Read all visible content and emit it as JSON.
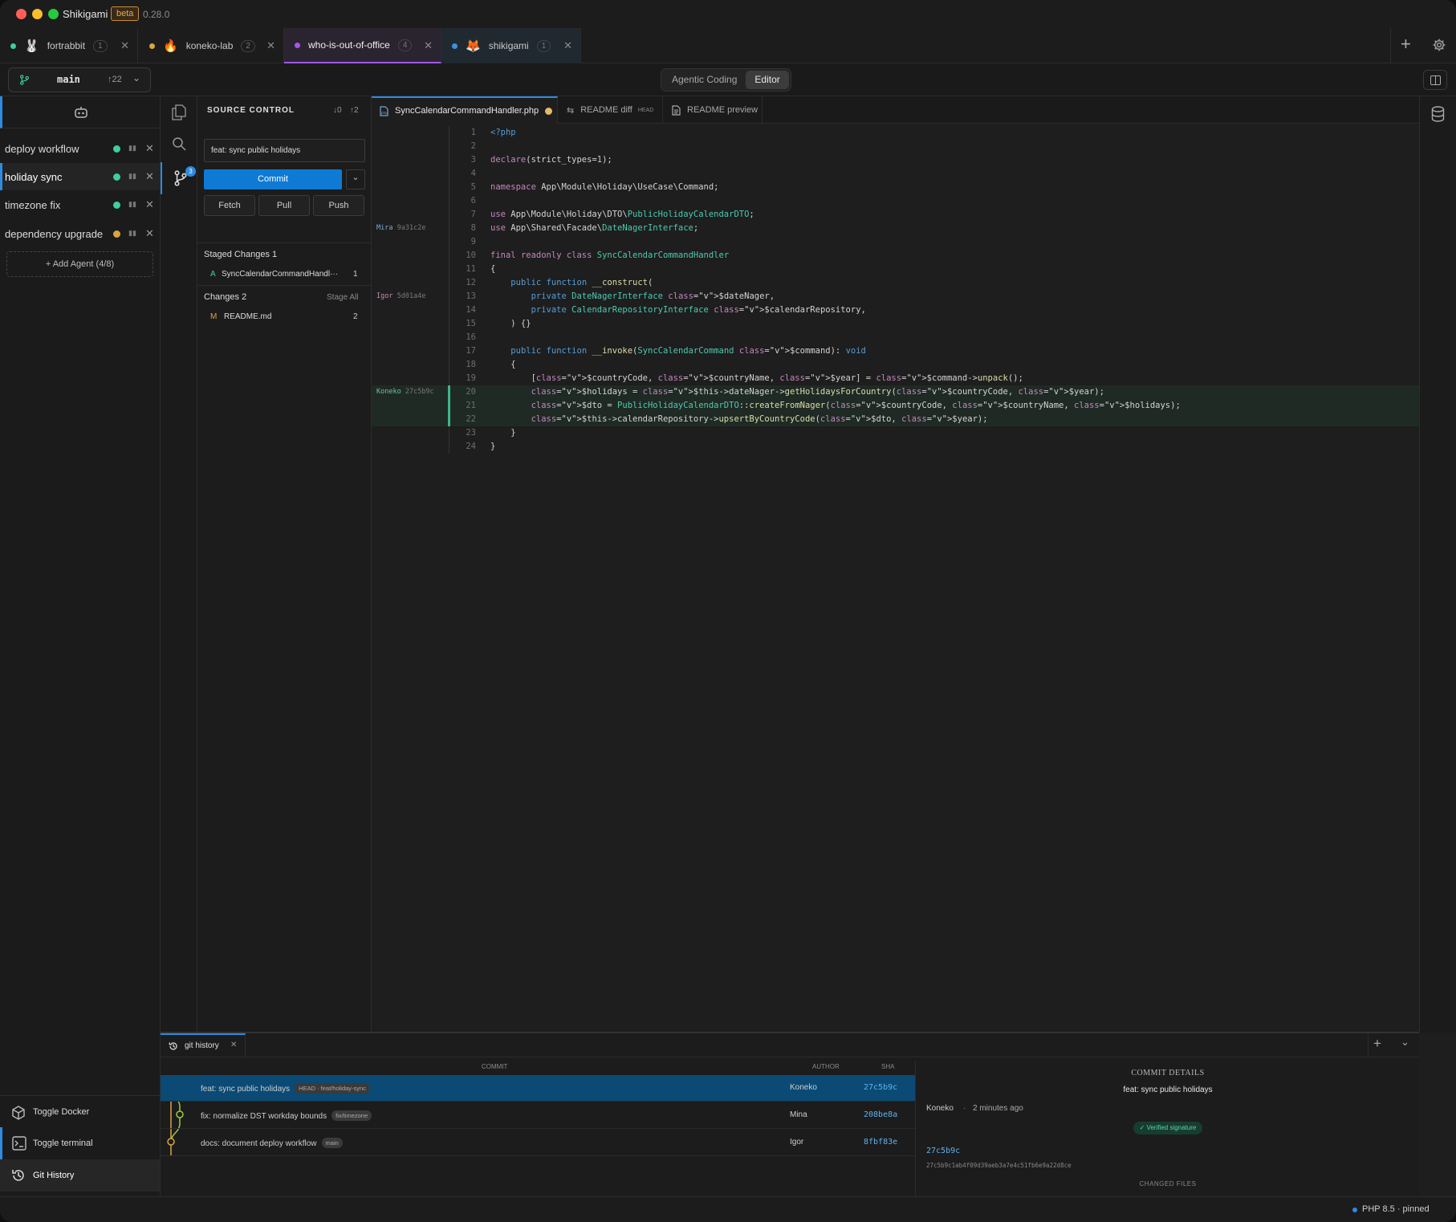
{
  "app": {
    "name": "Shikigami",
    "badge": "beta",
    "version": "0.28.0"
  },
  "project_tabs": [
    {
      "label": "fortrabbit",
      "count": "1",
      "dot": "#3ecf9a",
      "emoji": "🐰"
    },
    {
      "label": "koneko-lab",
      "count": "2",
      "dot": "#d9a441",
      "emoji": "🔥"
    },
    {
      "label": "who-is-out-of-office",
      "count": "4",
      "dot": "#a259e6",
      "emoji": ""
    },
    {
      "label": "shikigami",
      "count": "1",
      "dot": "#3d8fe0",
      "emoji": "🦊"
    }
  ],
  "toolbar": {
    "branch": "main",
    "ahead": "↑22",
    "modes": [
      "Agentic Coding",
      "Editor"
    ],
    "active_mode": "Editor"
  },
  "agents": [
    {
      "label": "deploy workflow",
      "status": "#3ecf9a"
    },
    {
      "label": "holiday sync",
      "status": "#3ecf9a",
      "active": true
    },
    {
      "label": "timezone fix",
      "status": "#3ecf9a"
    },
    {
      "label": "dependency upgrade",
      "status": "#d9a441"
    }
  ],
  "add_agent": "+ Add Agent (4/8)",
  "bottom_nav": [
    "Toggle Docker",
    "Toggle terminal",
    "Git History"
  ],
  "activity_badge": "3",
  "scm": {
    "title": "SOURCE CONTROL",
    "incoming": "↓0",
    "outgoing": "↑2",
    "message": "feat: sync public holidays",
    "commit": "Commit",
    "fetch": "Fetch",
    "pull": "Pull",
    "push": "Push",
    "staged_header": "Staged Changes 1",
    "staged": [
      {
        "status": "A",
        "name": "SyncCalendarCommandHandl···",
        "count": "1"
      }
    ],
    "changes_header": "Changes 2",
    "stage_all": "Stage All",
    "changes": [
      {
        "status": "M",
        "name": "README.md",
        "count": "2"
      }
    ]
  },
  "editor_tabs": [
    {
      "label": "SyncCalendarCommandHandler.php",
      "active": true
    },
    {
      "label": "README diff",
      "tag": "HEAD"
    },
    {
      "label": "README preview"
    }
  ],
  "blame": [
    {
      "line": 8,
      "author": "Mira",
      "sha": "9a31c2e"
    },
    {
      "line": 13,
      "author": "Igor",
      "sha": "5d01a4e"
    },
    {
      "line": 20,
      "author": "Koneko",
      "sha": "27c5b9c"
    }
  ],
  "code_lines": [
    "<?php",
    "",
    "declare(strict_types=1);",
    "",
    "namespace App\\Module\\Holiday\\UseCase\\Command;",
    "",
    "use App\\Module\\Holiday\\DTO\\PublicHolidayCalendarDTO;",
    "use App\\Shared\\Facade\\DateNagerInterface;",
    "",
    "final readonly class SyncCalendarCommandHandler",
    "{",
    "    public function __construct(",
    "        private DateNagerInterface $dateNager,",
    "        private CalendarRepositoryInterface $calendarRepository,",
    "    ) {}",
    "",
    "    public function __invoke(SyncCalendarCommand $command): void",
    "    {",
    "        [$countryCode, $countryName, $year] = $command->unpack();",
    "        $holidays = $this->dateNager->getHolidaysForCountry($countryCode, $year);",
    "        $dto = PublicHolidayCalendarDTO::createFromNager($countryCode, $countryName, $holidays);",
    "        $this->calendarRepository->upsertByCountryCode($dto, $year);",
    "    }",
    "}"
  ],
  "git_history": {
    "tab": "git history",
    "columns": [
      "COMMIT",
      "AUTHOR",
      "SHA"
    ],
    "commits": [
      {
        "message": "feat: sync public holidays",
        "ref": "HEAD · feat/holiday-sync",
        "author": "Koneko",
        "sha": "27c5b9c"
      },
      {
        "message": "fix: normalize DST workday bounds",
        "ref": "fix/timezone",
        "author": "Mina",
        "sha": "208be8a"
      },
      {
        "message": "docs: document deploy workflow",
        "ref": "main",
        "author": "Igor",
        "sha": "8fbf83e"
      }
    ],
    "details": {
      "title": "COMMIT DETAILS",
      "subject": "feat: sync public holidays",
      "author": "Koneko",
      "when": "2 minutes ago",
      "signature": "✓ Verified signature",
      "sha": "27c5b9c",
      "full_sha": "27c5b9c1ab4f09d39aeb3a7e4c51fb6e9a22d8ce",
      "changed_files": "CHANGED FILES"
    }
  },
  "status": {
    "runtime": "PHP 8.5 · pinned"
  }
}
